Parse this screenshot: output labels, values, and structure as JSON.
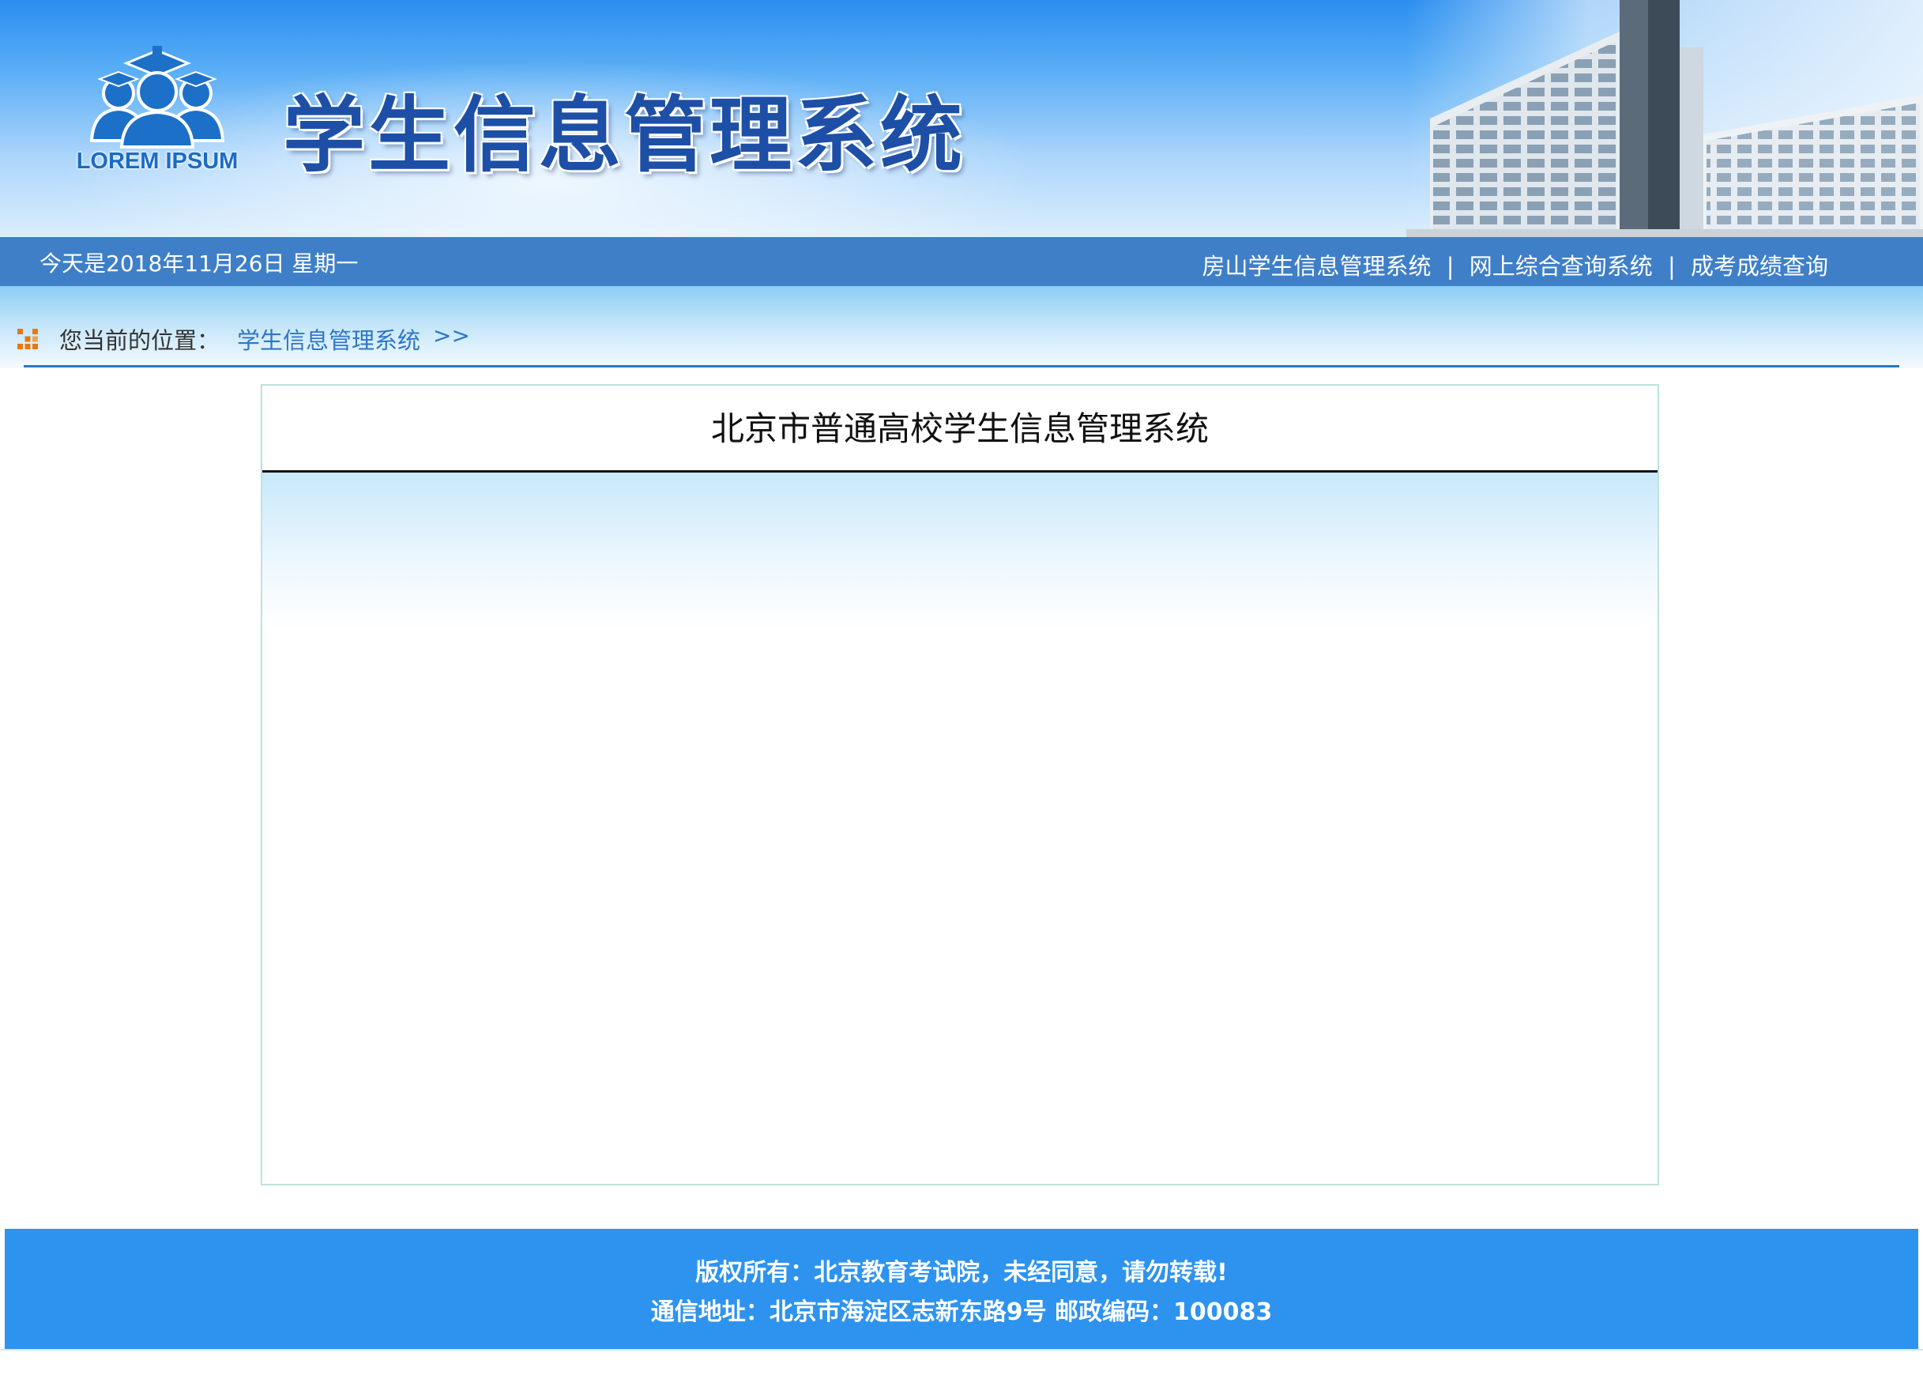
{
  "header": {
    "logo_text": "LOREM IPSUM",
    "site_title": "学生信息管理系统"
  },
  "topbar": {
    "date_text": "今天是2018年11月26日  星期一",
    "links": [
      {
        "label": "房山学生信息管理系统"
      },
      {
        "label": "网上综合查询系统"
      },
      {
        "label": "成考成绩查询"
      }
    ],
    "separator": "|"
  },
  "breadcrumb": {
    "label": "您当前的位置：",
    "current": "学生信息管理系统",
    "arrow": ">>"
  },
  "main": {
    "panel_title": "北京市普通高校学生信息管理系统"
  },
  "footer": {
    "copyright": "版权所有：北京教育考试院，未经同意，请勿转载!",
    "address": "通信地址：北京市海淀区志新东路9号 邮政编码：100083"
  },
  "colors": {
    "header_bar": "#3f7fc8",
    "title_blue": "#1d4fa6",
    "footer_bg": "#2d93ef",
    "link_blue": "#2f76c6",
    "panel_border": "#bfe2de"
  },
  "icons": {
    "logo": "students-graduation-icon",
    "breadcrumb": "grid-dots-icon"
  }
}
